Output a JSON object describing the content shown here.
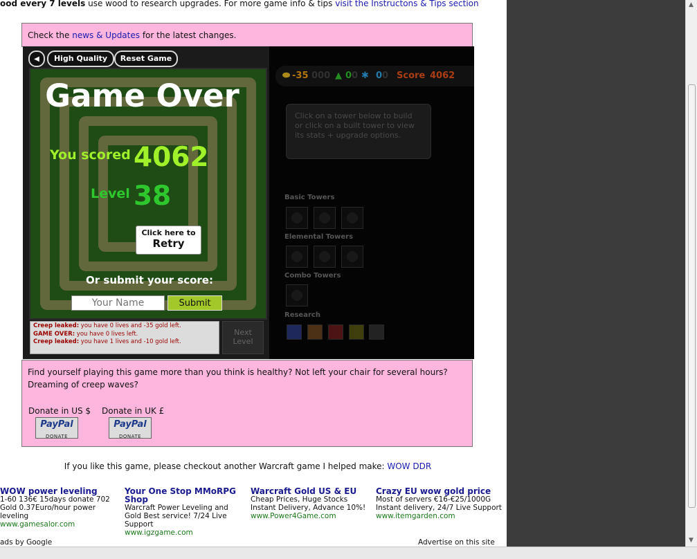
{
  "top_line": {
    "bold": "ood every 7 levels",
    "text": " use wood to research upgrades. For more game info & tips ",
    "link": "visit the Instructons & Tips section"
  },
  "news": {
    "pre": "Check the ",
    "link": "news & Updates",
    "post": " for the latest changes."
  },
  "controls": {
    "high_quality": "High Quality",
    "reset_game": "Reset Game"
  },
  "game_over": {
    "title": "Game Over",
    "score_label": "You scored",
    "score": "4062",
    "level_label": "Level",
    "level": "38",
    "retry_small": "Click here to",
    "retry_big": "Retry",
    "submit_label": "Or submit your score:",
    "name_placeholder": "Your Name",
    "submit_button": "Submit"
  },
  "log": [
    {
      "key": "Creep leaked:",
      "msg": " you have 0 lives and -35 gold left."
    },
    {
      "key": "GAME OVER:",
      "msg": " you have 0 lives left."
    },
    {
      "key": "Creep leaked:",
      "msg": " you have 1 lives and -10 gold left."
    }
  ],
  "next_level": "Next Level",
  "stats": {
    "gold": "-35",
    "gold_ghost": "000",
    "wood": "0",
    "wood_ghost": "0",
    "lives": "0",
    "lives_ghost": "0",
    "score_label": "Score",
    "score": "4062"
  },
  "info_text": "Click on a tower below to build or click on a built tower to view its stats + upgrade options.",
  "sections": {
    "basic": "Basic Towers",
    "elemental": "Elemental Towers",
    "combo": "Combo Towers",
    "research": "Research"
  },
  "research_colors": [
    "#24306a",
    "#5a3a1a",
    "#5a1818",
    "#4a4a10",
    "#2a2a2a"
  ],
  "donate": {
    "line1": "Find yourself playing this game more than you think is healthy? Not left your chair for several hours?",
    "line2": "Dreaming of creep waves?",
    "us_label": "Donate in US $",
    "uk_label": "Donate in UK £",
    "paypal": "PayPal",
    "paypal_sub": "DONATE"
  },
  "wowddr": {
    "text": "If you like this game, please checkout another Warcraft game I helped make: ",
    "link": "WOW DDR"
  },
  "ads": [
    {
      "title": "WOW power leveling",
      "desc": "1-60 136€ 15days donate 702 Gold 0.37Euro/hour power leveling",
      "url": "www.gamesalor.com"
    },
    {
      "title": "Your One Stop MMoRPG Shop",
      "desc": "Warcraft Power Leveling and Gold Best service! 7/24 Live Support",
      "url": "www.igzgame.com"
    },
    {
      "title": "Warcraft Gold US & EU",
      "desc": "Cheap Prices, Huge Stocks Instant Delivery, Advance 10%!",
      "url": "www.Power4Game.com"
    },
    {
      "title": "Crazy EU wow gold price",
      "desc": "Most of servers €16-€25/1000G Instant delivery, 24/7 Live Support",
      "url": "www.itemgarden.com"
    }
  ],
  "ads_by": "ads by Google",
  "advertise": "Advertise on this site"
}
